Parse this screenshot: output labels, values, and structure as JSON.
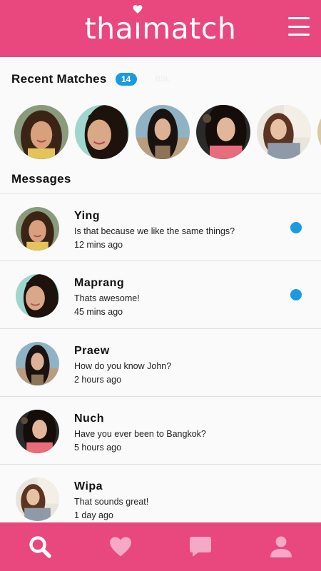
{
  "header": {
    "logo_before": "tha",
    "logo_after": "match",
    "menu_icon": "hamburger-menu-icon"
  },
  "colors": {
    "brand_pink": "#e8487d",
    "badge_blue": "#1a9be0",
    "nav_icon_active": "#ffffff",
    "nav_icon_inactive": "#f6a9c4"
  },
  "recent_matches": {
    "title": "Recent Matches",
    "count": "14",
    "faded_label": "BSL",
    "avatars": [
      {
        "name": "Ying"
      },
      {
        "name": "Maprang"
      },
      {
        "name": "Praew"
      },
      {
        "name": "Nuch"
      },
      {
        "name": "Wipa"
      }
    ]
  },
  "messages": {
    "title": "Messages",
    "items": [
      {
        "name": "Ying",
        "text": "Is that because we like the same things?",
        "time": "12 mins ago",
        "unread": true
      },
      {
        "name": "Maprang",
        "text": "Thats awesome!",
        "time": "45 mins ago",
        "unread": true
      },
      {
        "name": "Praew",
        "text": "How do you know John?",
        "time": "2 hours ago",
        "unread": false
      },
      {
        "name": "Nuch",
        "text": "Have you ever been to Bangkok?",
        "time": "5 hours ago",
        "unread": false
      },
      {
        "name": "Wipa",
        "text": "That sounds great!",
        "time": "1 day ago",
        "unread": false
      }
    ]
  },
  "bottom_nav": {
    "items": [
      {
        "icon": "search-icon",
        "active": true
      },
      {
        "icon": "heart-icon",
        "active": false
      },
      {
        "icon": "chat-bubble-icon",
        "active": false
      },
      {
        "icon": "profile-icon",
        "active": false
      }
    ]
  }
}
